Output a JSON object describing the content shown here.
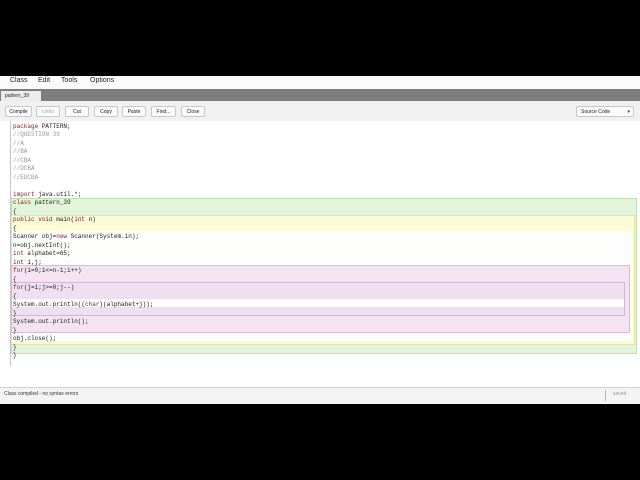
{
  "menu": [
    "Class",
    "Edit",
    "Tools",
    "Options"
  ],
  "tab": {
    "label": "pattern_39"
  },
  "toolbar": {
    "buttons": [
      "Compile",
      "Undo",
      "Cut",
      "Copy",
      "Paste",
      "Find...",
      "Close"
    ],
    "view_select": "Source Code"
  },
  "code": {
    "lines": [
      "package PATTERN;",
      "//QUESTION 39",
      "//A",
      "//BA",
      "//CBA",
      "//DCBA",
      "//EDCBA",
      "",
      "import java.util.*;",
      "class pattern_39",
      "{",
      "public void main(int n)",
      "{",
      "Scanner obj=new Scanner(System.in);",
      "n=obj.nextInt();",
      "int alphabet=65;",
      "int i,j;",
      "for(i=0;i<=n-1;i++)",
      "{",
      "for(j=i;j>=0;j--)",
      "{",
      "System.out.println((char)(alphabet+j));",
      "}",
      "System.out.println();",
      "}",
      "obj.close();",
      "}",
      "}"
    ]
  },
  "status": {
    "message": "Class compiled - no syntax errors",
    "state": "saved"
  }
}
